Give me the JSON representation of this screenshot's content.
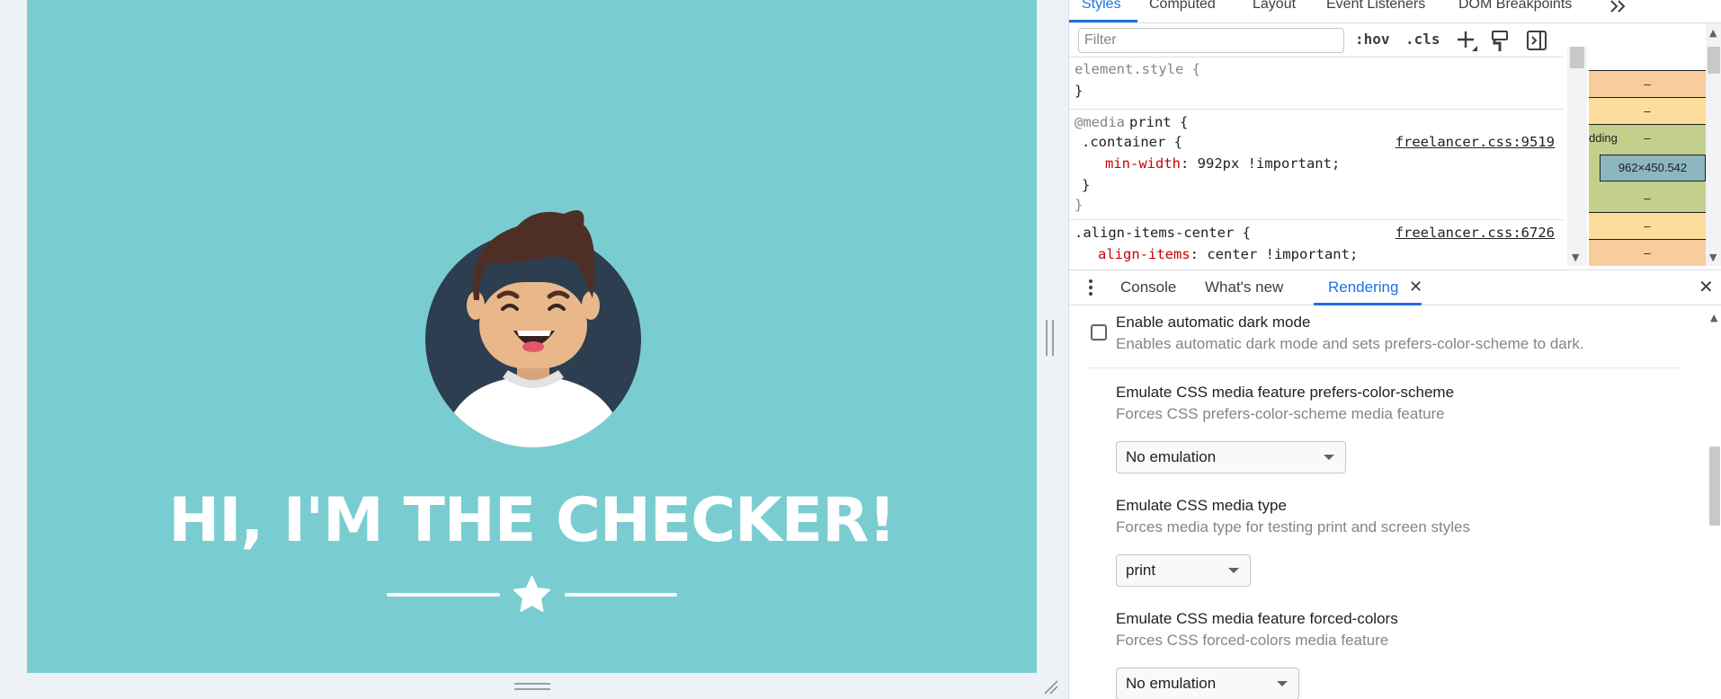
{
  "page": {
    "headline": "HI, I'M THE CHECKER!",
    "colors": {
      "viewport_bg": "#79cdd1",
      "avatar_circle": "#2c3e50",
      "text": "#ffffff"
    }
  },
  "devtools": {
    "tabs": [
      "Styles",
      "Computed",
      "Layout",
      "Event Listeners",
      "DOM Breakpoints"
    ],
    "more_tabs_icon": "double-chevron-right-icon",
    "filter_placeholder": "Filter",
    "hov": ":hov",
    "cls": ".cls",
    "styles": {
      "element_style": "element.style {",
      "close_brace": "}",
      "media_keyword": "@media",
      "media_query": "print {",
      "container_selector": ".container {",
      "container_source": "freelancer.css:9519",
      "min_width_prop": "min-width",
      "min_width_value": ": 992px !important;",
      "inner_close": "}",
      "outer_close": "}",
      "align_selector": ".align-items-center {",
      "align_source": "freelancer.css:6726",
      "align_prop": "align-items",
      "align_value": ": center !important;"
    },
    "box_model": {
      "padding_label": "dding",
      "dash": "–",
      "content_size": "962×450.542"
    },
    "drawer_tabs": [
      "Console",
      "What's new",
      "Rendering"
    ],
    "rendering": {
      "dark_mode_title": "Enable automatic dark mode",
      "dark_mode_desc": "Enables automatic dark mode and sets prefers-color-scheme to dark.",
      "dark_mode_checked": false,
      "pcs_title": "Emulate CSS media feature prefers-color-scheme",
      "pcs_desc": "Forces CSS prefers-color-scheme media feature",
      "pcs_value": "No emulation",
      "media_type_title": "Emulate CSS media type",
      "media_type_desc": "Forces media type for testing print and screen styles",
      "media_type_value": "print",
      "forced_colors_title": "Emulate CSS media feature forced-colors",
      "forced_colors_desc": "Forces CSS forced-colors media feature",
      "forced_colors_value": "No emulation"
    }
  }
}
